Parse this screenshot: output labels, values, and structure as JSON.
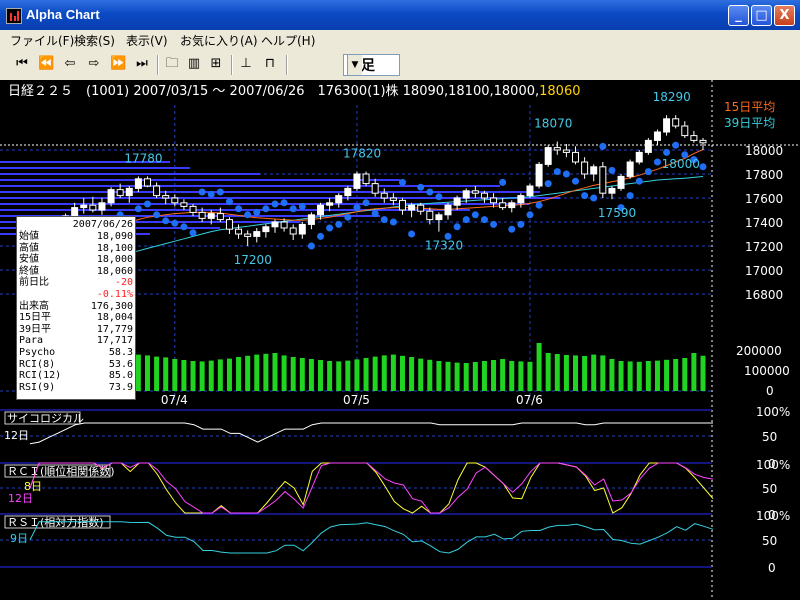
{
  "window": {
    "title": "Alpha Chart",
    "minimize": "_",
    "maximize": "□",
    "close": "X"
  },
  "menu": [
    "ファイル(F)",
    "検索(S)",
    "表示(V)",
    "お気に入り(A)",
    "ヘルプ(H)"
  ],
  "toolbar": {
    "period": "日足"
  },
  "header": {
    "text": "日経２２５　(1001) 2007/03/15 ～ 2007/06/26　176300(1)株 18090,18100,18000,",
    "close_text": "18060"
  },
  "legend": {
    "ma15": "15日平均",
    "ma39": "39日平均"
  },
  "colors": {
    "ma15": "#ff6a1a",
    "ma39": "#35d0e0",
    "para": "#1e6ff5",
    "volume": "#21d421",
    "label": "#45c8e8"
  },
  "price_axis": [
    "18000",
    "17800",
    "17600",
    "17400",
    "17200",
    "17000",
    "16800"
  ],
  "volume_axis": [
    "200000",
    "100000",
    "0"
  ],
  "month_labels": [
    "07/4",
    "07/5",
    "07/6"
  ],
  "annotations": [
    "17780",
    "17820",
    "18070",
    "18290",
    "18000",
    "17590",
    "17320",
    "17200"
  ],
  "info_box": {
    "date": "2007/06/26",
    "rows": [
      {
        "label": "始値",
        "value": "18,090"
      },
      {
        "label": "高値",
        "value": "18,100"
      },
      {
        "label": "安値",
        "value": "18,000"
      },
      {
        "label": "終値",
        "value": "18,060"
      },
      {
        "label": "前日比",
        "value": "-20"
      },
      {
        "label": "",
        "value": "-0.11%"
      },
      {
        "label": "出来高",
        "value": "176,300"
      },
      {
        "label": "15日平",
        "value": "18,004"
      },
      {
        "label": "39日平",
        "value": "17,779"
      },
      {
        "label": "Para",
        "value": "17,717"
      },
      {
        "label": "Psycho",
        "value": "58.3"
      },
      {
        "label": "RCI(8)",
        "value": "53.6"
      },
      {
        "label": "RCI(12)",
        "value": "85.0"
      },
      {
        "label": "RSI(9)",
        "value": "73.9"
      }
    ]
  },
  "psycho_panel": {
    "title": "サイコロジカル",
    "period": "12日",
    "axis": [
      "100%",
      "50",
      "0"
    ]
  },
  "rci_panel": {
    "title": "ＲＣＩ(順位相関係数)",
    "periods": [
      "8日",
      "12日"
    ],
    "axis": [
      "100%",
      "50",
      "0"
    ]
  },
  "rsi_panel": {
    "title": "ＲＳＩ(相対力指数)",
    "period": "9日",
    "axis": [
      "100%",
      "50",
      "0"
    ]
  },
  "chart_data": [
    {
      "type": "candlestick",
      "title": "日経２２５　(1001) 2007/03/15 ～ 2007/06/26",
      "x": [
        "2007-03-15",
        "2007-06-26"
      ],
      "month_ticks": [
        "07/4",
        "07/5",
        "07/6"
      ],
      "ylim": [
        16700,
        18300
      ],
      "last": {
        "open": 18090,
        "high": 18100,
        "low": 18000,
        "close": 18060
      },
      "ohlc": [
        [
          17040,
          17140,
          17020,
          17120
        ],
        [
          17130,
          17180,
          17080,
          17160
        ],
        [
          17160,
          17250,
          17130,
          17240
        ],
        [
          17240,
          17330,
          17200,
          17310
        ],
        [
          17310,
          17420,
          17260,
          17380
        ],
        [
          17380,
          17470,
          17330,
          17450
        ],
        [
          17450,
          17560,
          17420,
          17520
        ],
        [
          17520,
          17600,
          17470,
          17540
        ],
        [
          17540,
          17610,
          17480,
          17500
        ],
        [
          17500,
          17600,
          17460,
          17560
        ],
        [
          17560,
          17690,
          17530,
          17670
        ],
        [
          17670,
          17720,
          17600,
          17620
        ],
        [
          17620,
          17700,
          17560,
          17680
        ],
        [
          17680,
          17780,
          17650,
          17760
        ],
        [
          17760,
          17780,
          17690,
          17700
        ],
        [
          17700,
          17730,
          17600,
          17620
        ],
        [
          17620,
          17660,
          17550,
          17600
        ],
        [
          17600,
          17630,
          17530,
          17560
        ],
        [
          17560,
          17590,
          17500,
          17530
        ],
        [
          17530,
          17550,
          17450,
          17480
        ],
        [
          17480,
          17520,
          17400,
          17430
        ],
        [
          17430,
          17500,
          17380,
          17470
        ],
        [
          17470,
          17520,
          17400,
          17420
        ],
        [
          17420,
          17440,
          17300,
          17340
        ],
        [
          17340,
          17380,
          17260,
          17300
        ],
        [
          17300,
          17330,
          17200,
          17280
        ],
        [
          17280,
          17350,
          17230,
          17320
        ],
        [
          17320,
          17380,
          17270,
          17360
        ],
        [
          17360,
          17420,
          17310,
          17400
        ],
        [
          17400,
          17430,
          17320,
          17350
        ],
        [
          17350,
          17380,
          17250,
          17300
        ],
        [
          17300,
          17400,
          17260,
          17380
        ],
        [
          17380,
          17480,
          17340,
          17460
        ],
        [
          17460,
          17560,
          17420,
          17540
        ],
        [
          17540,
          17600,
          17490,
          17560
        ],
        [
          17560,
          17640,
          17520,
          17620
        ],
        [
          17620,
          17700,
          17580,
          17680
        ],
        [
          17680,
          17820,
          17660,
          17800
        ],
        [
          17800,
          17820,
          17700,
          17720
        ],
        [
          17720,
          17760,
          17610,
          17640
        ],
        [
          17640,
          17680,
          17560,
          17600
        ],
        [
          17600,
          17640,
          17540,
          17580
        ],
        [
          17580,
          17600,
          17460,
          17500
        ],
        [
          17500,
          17560,
          17440,
          17540
        ],
        [
          17540,
          17560,
          17460,
          17490
        ],
        [
          17490,
          17520,
          17380,
          17420
        ],
        [
          17420,
          17480,
          17320,
          17460
        ],
        [
          17460,
          17560,
          17420,
          17540
        ],
        [
          17540,
          17620,
          17500,
          17600
        ],
        [
          17600,
          17680,
          17560,
          17660
        ],
        [
          17660,
          17700,
          17600,
          17640
        ],
        [
          17640,
          17660,
          17560,
          17600
        ],
        [
          17600,
          17640,
          17520,
          17560
        ],
        [
          17560,
          17600,
          17500,
          17520
        ],
        [
          17520,
          17580,
          17480,
          17560
        ],
        [
          17560,
          17640,
          17520,
          17620
        ],
        [
          17620,
          17720,
          17600,
          17700
        ],
        [
          17700,
          17900,
          17680,
          17880
        ],
        [
          17880,
          18040,
          17860,
          18020
        ],
        [
          18020,
          18070,
          17960,
          18000
        ],
        [
          18000,
          18050,
          17940,
          17980
        ],
        [
          17980,
          18030,
          17880,
          17900
        ],
        [
          17900,
          17940,
          17760,
          17800
        ],
        [
          17800,
          17880,
          17740,
          17860
        ],
        [
          17860,
          17900,
          17600,
          17640
        ],
        [
          17640,
          17700,
          17590,
          17680
        ],
        [
          17680,
          17800,
          17660,
          17780
        ],
        [
          17780,
          17920,
          17760,
          17900
        ],
        [
          17900,
          18000,
          17880,
          17980
        ],
        [
          17980,
          18100,
          17960,
          18080
        ],
        [
          18080,
          18170,
          18040,
          18150
        ],
        [
          18150,
          18290,
          18120,
          18260
        ],
        [
          18260,
          18290,
          18180,
          18200
        ],
        [
          18200,
          18240,
          18100,
          18120
        ],
        [
          18120,
          18160,
          18060,
          18080
        ],
        [
          18080,
          18100,
          18000,
          18060
        ]
      ],
      "ma15": [
        17000,
        17030,
        17060,
        17090,
        17120,
        17160,
        17200,
        17240,
        17280,
        17320,
        17350,
        17380,
        17400,
        17420,
        17440,
        17450,
        17460,
        17470,
        17475,
        17480,
        17480,
        17480,
        17475,
        17465,
        17455,
        17445,
        17435,
        17430,
        17425,
        17420,
        17415,
        17415,
        17420,
        17430,
        17440,
        17455,
        17470,
        17485,
        17500,
        17510,
        17515,
        17520,
        17520,
        17520,
        17515,
        17510,
        17505,
        17505,
        17510,
        17515,
        17520,
        17525,
        17530,
        17535,
        17540,
        17545,
        17555,
        17570,
        17590,
        17615,
        17640,
        17665,
        17685,
        17705,
        17720,
        17735,
        17750,
        17770,
        17790,
        17815,
        17840,
        17870,
        17900,
        17930,
        17970,
        18004
      ],
      "ma39": [
        16900,
        16920,
        16940,
        16960,
        16980,
        17000,
        17020,
        17040,
        17060,
        17080,
        17100,
        17120,
        17140,
        17160,
        17180,
        17200,
        17220,
        17240,
        17260,
        17280,
        17300,
        17320,
        17335,
        17345,
        17355,
        17365,
        17375,
        17385,
        17395,
        17405,
        17415,
        17425,
        17435,
        17445,
        17455,
        17465,
        17475,
        17485,
        17495,
        17505,
        17515,
        17525,
        17535,
        17545,
        17550,
        17555,
        17560,
        17565,
        17570,
        17575,
        17580,
        17585,
        17590,
        17595,
        17600,
        17605,
        17610,
        17620,
        17630,
        17640,
        17650,
        17660,
        17670,
        17680,
        17690,
        17700,
        17710,
        17720,
        17730,
        17740,
        17750,
        17755,
        17760,
        17765,
        17772,
        17779
      ]
    },
    {
      "type": "bar",
      "title": "出来高",
      "ylim": [
        0,
        250000
      ],
      "values": [
        182000,
        170000,
        165000,
        158000,
        150000,
        160000,
        168000,
        176000,
        182000,
        190000,
        170000,
        175000,
        180000,
        182000,
        178000,
        172000,
        168000,
        160000,
        155000,
        150000,
        148000,
        152000,
        158000,
        162000,
        170000,
        176000,
        182000,
        186000,
        190000,
        178000,
        170000,
        165000,
        160000,
        155000,
        150000,
        148000,
        152000,
        158000,
        165000,
        172000,
        178000,
        182000,
        176000,
        170000,
        162000,
        156000,
        150000,
        146000,
        142000,
        140000,
        145000,
        150000,
        155000,
        160000,
        150000,
        148000,
        146000,
        240000,
        190000,
        185000,
        180000,
        178000,
        175000,
        182000,
        178000,
        160000,
        150000,
        148000,
        146000,
        150000,
        152000,
        156000,
        160000,
        165000,
        190000,
        176300
      ]
    }
  ]
}
